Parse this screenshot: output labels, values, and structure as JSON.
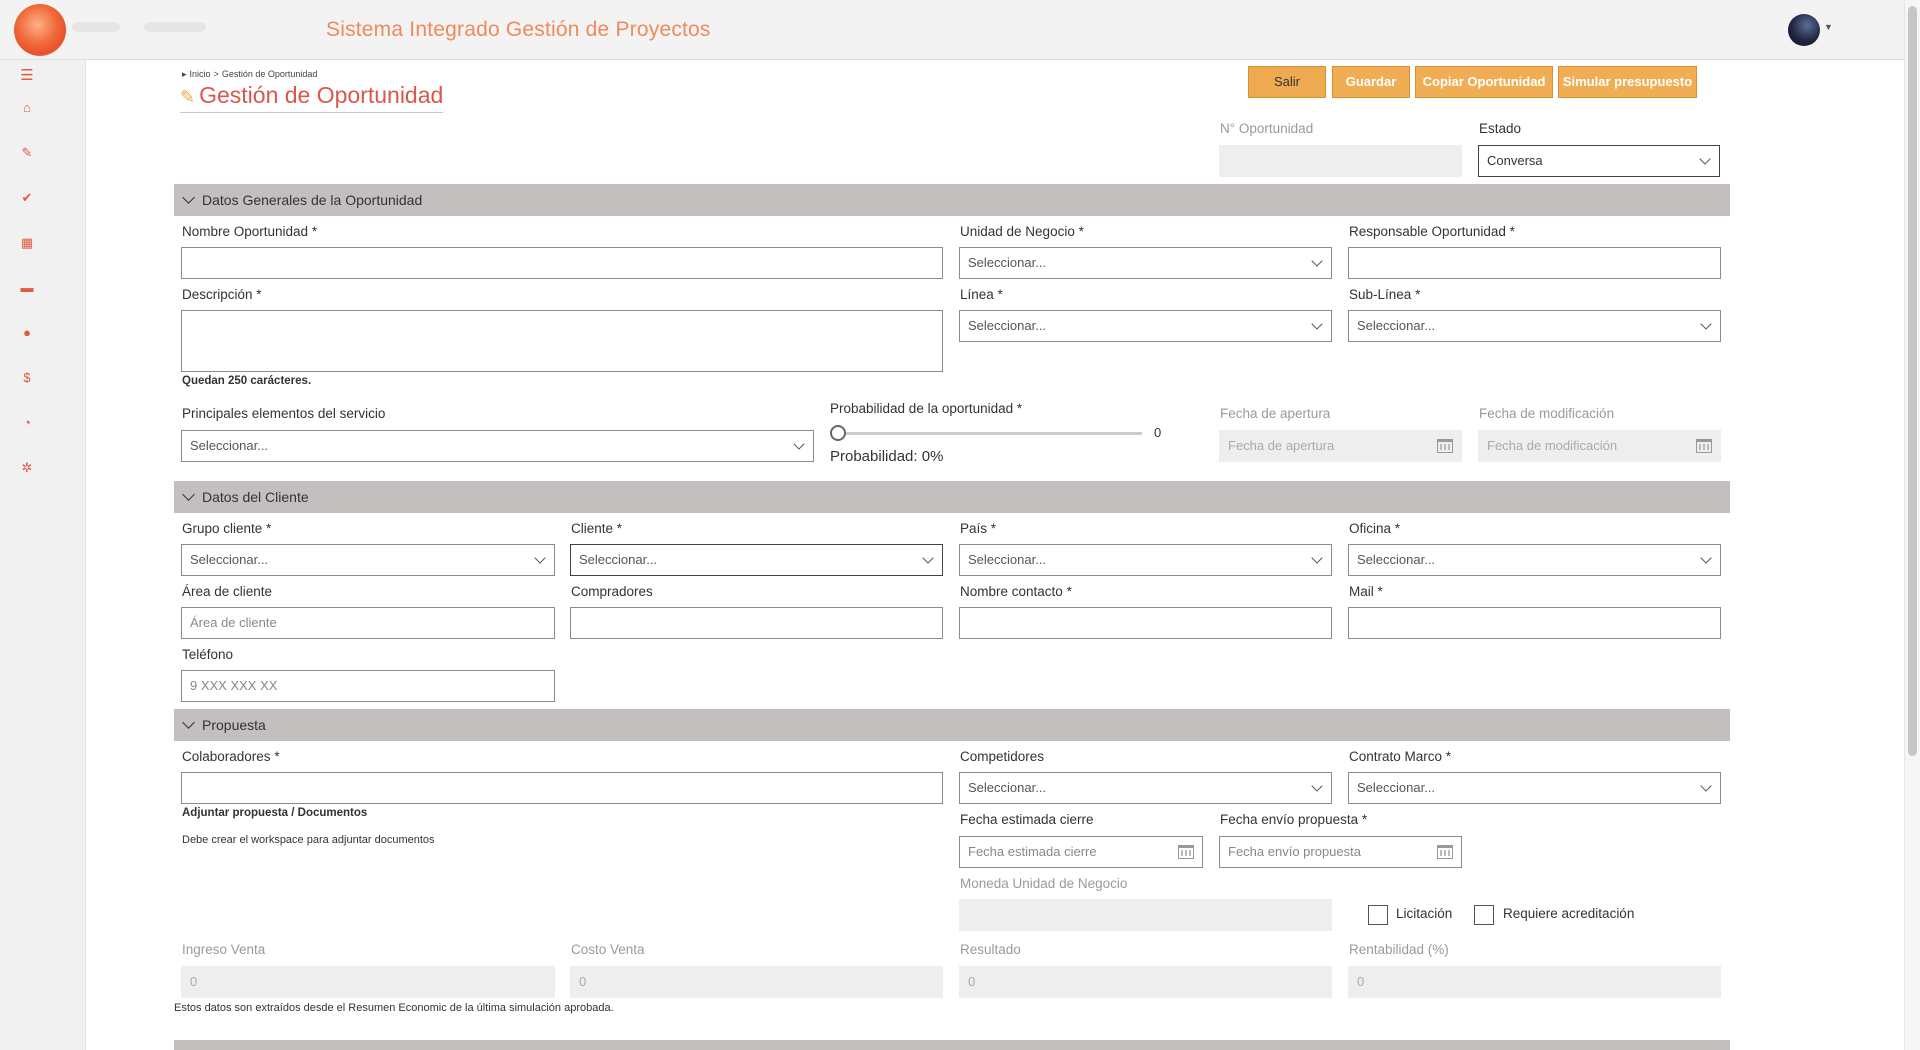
{
  "app": {
    "title": "Sistema Integrado Gestión de Proyectos"
  },
  "breadcrumb": [
    "Inicio",
    "Gestión de Oportunidad"
  ],
  "page": {
    "title": "Gestión de Oportunidad"
  },
  "toolbar": {
    "salir": "Salir",
    "guardar": "Guardar",
    "copiar": "Copiar Oportunidad",
    "simular": "Simular presupuesto"
  },
  "sidebar": {
    "items": [
      "menu-icon",
      "home-icon",
      "pin-icon",
      "check-icon",
      "calendar-icon",
      "briefcase-icon",
      "user-icon",
      "dollar-icon",
      "clock-icon",
      "gear-icon"
    ]
  },
  "header_fields": {
    "n_oportunidad": {
      "label": "N° Oportunidad",
      "value": ""
    },
    "estado": {
      "label": "Estado",
      "value": "Conversa"
    }
  },
  "datos_generales": {
    "title": "Datos Generales de la Oportunidad",
    "nombre": {
      "label": "Nombre Oportunidad",
      "value": ""
    },
    "unidad_negocio": {
      "label": "Unidad de Negocio",
      "placeholder": "Seleccionar..."
    },
    "responsable": {
      "label": "Responsable Oportunidad",
      "value": ""
    },
    "descripcion": {
      "label": "Descripción",
      "value": ""
    },
    "linea": {
      "label": "Línea",
      "placeholder": "Seleccionar..."
    },
    "sublinea": {
      "label": "Sub-Línea",
      "placeholder": "Seleccionar..."
    },
    "chars_left": "Quedan 250 carácteres.",
    "elementos": {
      "label": "Principales elementos del servicio",
      "placeholder": "Seleccionar..."
    },
    "probabilidad": {
      "label": "Probabilidad de la oportunidad",
      "value": "0",
      "text": "Probabilidad: 0%",
      "fraction": 0
    },
    "fecha_apertura": {
      "label": "Fecha de apertura",
      "placeholder": "Fecha de apertura"
    },
    "fecha_modificacion": {
      "label": "Fecha de modificación",
      "placeholder": "Fecha de modificación"
    }
  },
  "datos_cliente": {
    "title": "Datos del Cliente",
    "grupo": {
      "label": "Grupo cliente",
      "placeholder": "Seleccionar..."
    },
    "cliente": {
      "label": "Cliente",
      "placeholder": "Seleccionar..."
    },
    "pais": {
      "label": "País",
      "placeholder": "Seleccionar..."
    },
    "oficina": {
      "label": "Oficina",
      "placeholder": "Seleccionar..."
    },
    "area": {
      "label": "Área de cliente",
      "placeholder": "Área de cliente"
    },
    "compradores": {
      "label": "Compradores",
      "value": ""
    },
    "contacto": {
      "label": "Nombre contacto",
      "value": ""
    },
    "mail": {
      "label": "Mail",
      "value": ""
    },
    "telefono": {
      "label": "Teléfono",
      "placeholder": "9 XXX XXX XX"
    }
  },
  "propuesta": {
    "title": "Propuesta",
    "colaboradores": {
      "label": "Colaboradores",
      "value": ""
    },
    "competidores": {
      "label": "Competidores",
      "placeholder": "Seleccionar..."
    },
    "contrato_marco": {
      "label": "Contrato Marco",
      "placeholder": "Seleccionar..."
    },
    "adjuntar": "Adjuntar propuesta / Documentos",
    "workspace_note": "Debe crear el workspace para adjuntar documentos",
    "fecha_cierre": {
      "label": "Fecha estimada cierre",
      "placeholder": "Fecha estimada cierre"
    },
    "fecha_envio": {
      "label": "Fecha envío propuesta",
      "placeholder": "Fecha envío propuesta"
    },
    "moneda": {
      "label": "Moneda Unidad de Negocio",
      "value": ""
    },
    "licitacion": "Licitación",
    "acreditacion": "Requiere acreditación",
    "ingreso": {
      "label": "Ingreso Venta",
      "value": "0"
    },
    "costo": {
      "label": "Costo Venta",
      "value": "0"
    },
    "resultado": {
      "label": "Resultado",
      "value": "0"
    },
    "rentabilidad": {
      "label": "Rentabilidad (%)",
      "value": "0"
    },
    "resumen_note": "Estos datos son extraídos desde el Resumen Economic de la última simulación aprobada."
  },
  "colors": {
    "accent": "#f0ad54",
    "title": "#d8584a",
    "section_bg": "#c4bfbf",
    "icon": "#e05a44"
  }
}
